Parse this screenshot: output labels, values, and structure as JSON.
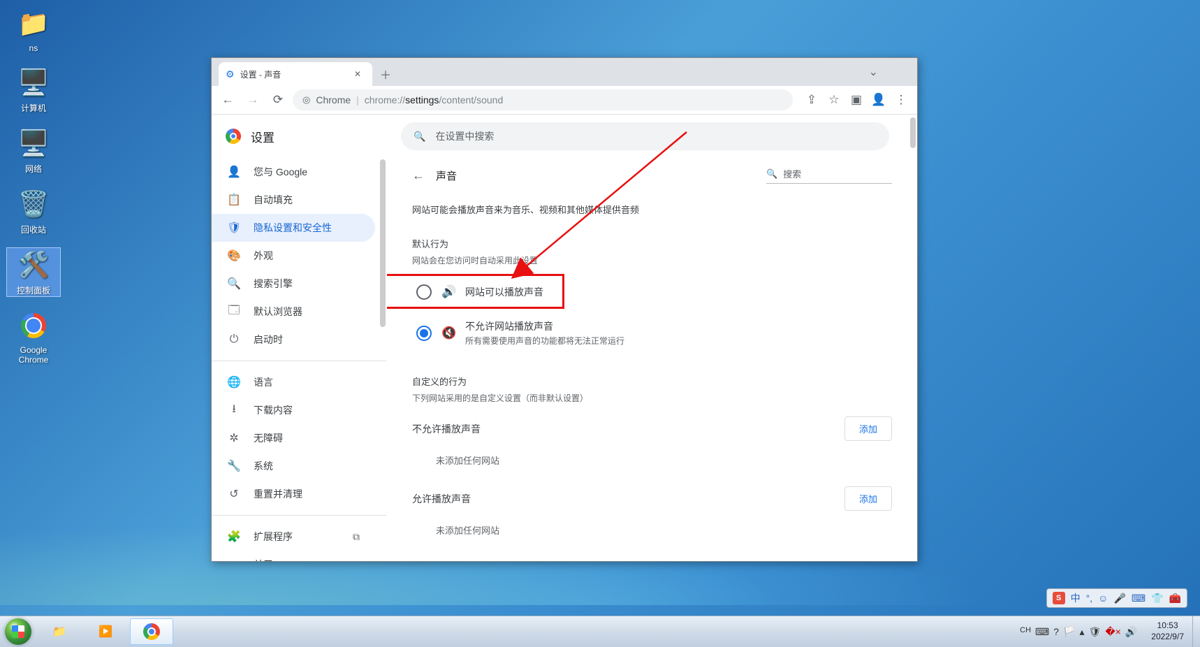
{
  "desktop": {
    "icons": [
      "ns",
      "计算机",
      "网络",
      "回收站",
      "控制面板",
      "Google Chrome"
    ]
  },
  "taskbar": {
    "time": "10:53",
    "date": "2022/9/7",
    "lang": "CH"
  },
  "ime": {
    "label": "中"
  },
  "chrome": {
    "tab_title": "设置 - 声音",
    "url_label": "Chrome",
    "url_prefix": "chrome://",
    "url_bold": "settings",
    "url_rest": "/content/sound",
    "settings_title": "设置",
    "search_placeholder": "在设置中搜索",
    "nav": [
      {
        "icon": "person",
        "label": "您与 Google"
      },
      {
        "icon": "clipboard",
        "label": "自动填充"
      },
      {
        "icon": "shield",
        "label": "隐私设置和安全性",
        "active": true
      },
      {
        "icon": "palette",
        "label": "外观"
      },
      {
        "icon": "search",
        "label": "搜索引擎"
      },
      {
        "icon": "browser",
        "label": "默认浏览器"
      },
      {
        "icon": "power",
        "label": "启动时"
      }
    ],
    "nav2": [
      {
        "icon": "globe",
        "label": "语言"
      },
      {
        "icon": "download",
        "label": "下载内容"
      },
      {
        "icon": "accessibility",
        "label": "无障碍"
      },
      {
        "icon": "wrench",
        "label": "系统"
      },
      {
        "icon": "reset",
        "label": "重置并清理"
      }
    ],
    "nav3": [
      {
        "icon": "puzzle",
        "label": "扩展程序",
        "ext": true
      },
      {
        "icon": "chrome",
        "label": "关于 Chrome"
      }
    ],
    "page": {
      "title": "声音",
      "search": "搜索",
      "desc": "网站可能会播放声音来为音乐、视频和其他媒体提供音频",
      "default_label": "默认行为",
      "default_sub": "网站会在您访问时自动采用此设置",
      "opt_allow": "网站可以播放声音",
      "opt_block": "不允许网站播放声音",
      "opt_block_sub": "所有需要使用声音的功能都将无法正常运行",
      "custom_label": "自定义的行为",
      "custom_sub": "下列网站采用的是自定义设置（而非默认设置）",
      "block_section": "不允许播放声音",
      "allow_section": "允许播放声音",
      "add": "添加",
      "empty": "未添加任何网站"
    }
  }
}
